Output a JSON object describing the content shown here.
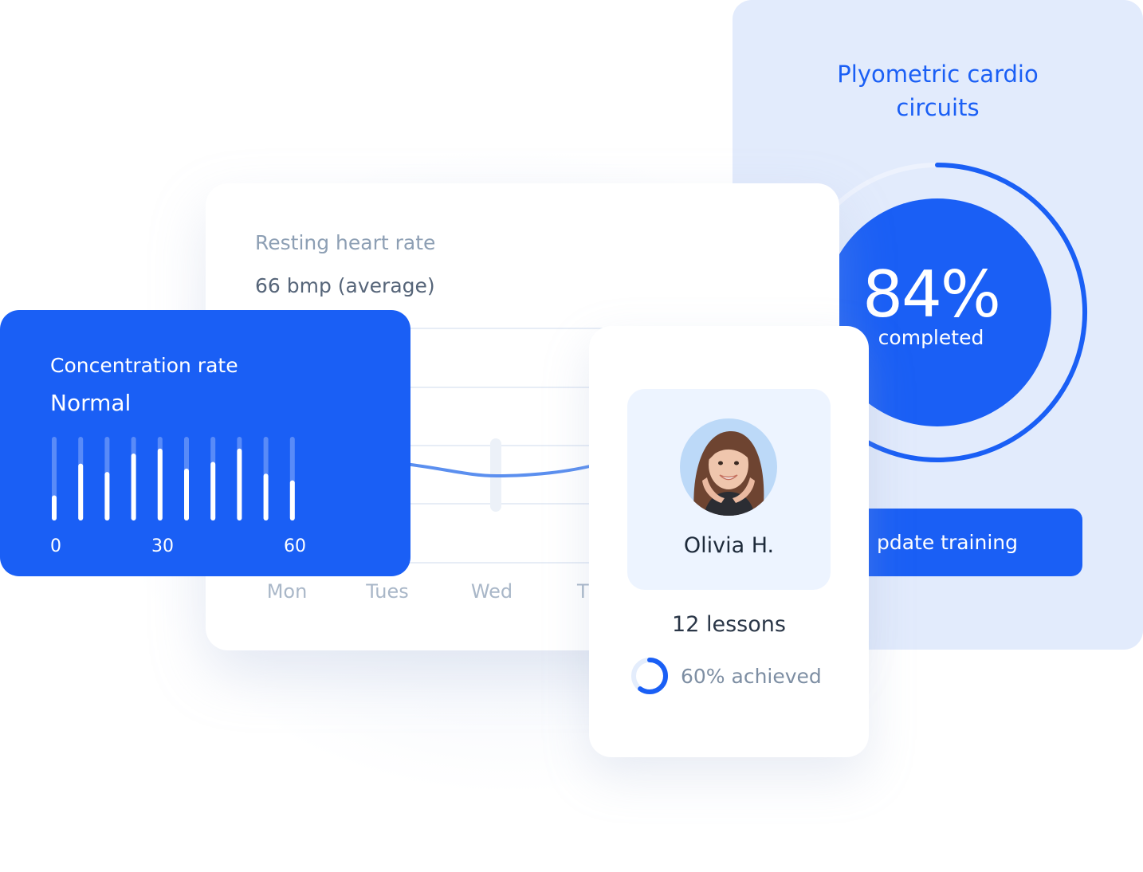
{
  "training": {
    "title": "Plyometric cardio circuits",
    "completed_percent_text": "84%",
    "completed_label": "completed",
    "completed_fraction": 0.84,
    "button_label": "pdate training"
  },
  "heart_rate": {
    "title": "Resting heart rate",
    "value": "66 bmp (average)",
    "days": [
      "Mon",
      "Tues",
      "Wed",
      "T"
    ]
  },
  "concentration": {
    "title": "Concentration rate",
    "status": "Normal",
    "bar_levels": [
      0.3,
      0.68,
      0.58,
      0.8,
      0.86,
      0.62,
      0.7,
      0.86,
      0.56,
      0.48
    ],
    "tick_labels": [
      "0",
      "30",
      "60"
    ]
  },
  "profile": {
    "name": "Olivia H.",
    "lessons": "12 lessons",
    "achieved": "60% achieved",
    "achieved_fraction": 0.6
  },
  "colors": {
    "brand_blue": "#1a5ff5",
    "training_bg": "#e2ebfc",
    "muted_text": "#8d9fb4"
  }
}
